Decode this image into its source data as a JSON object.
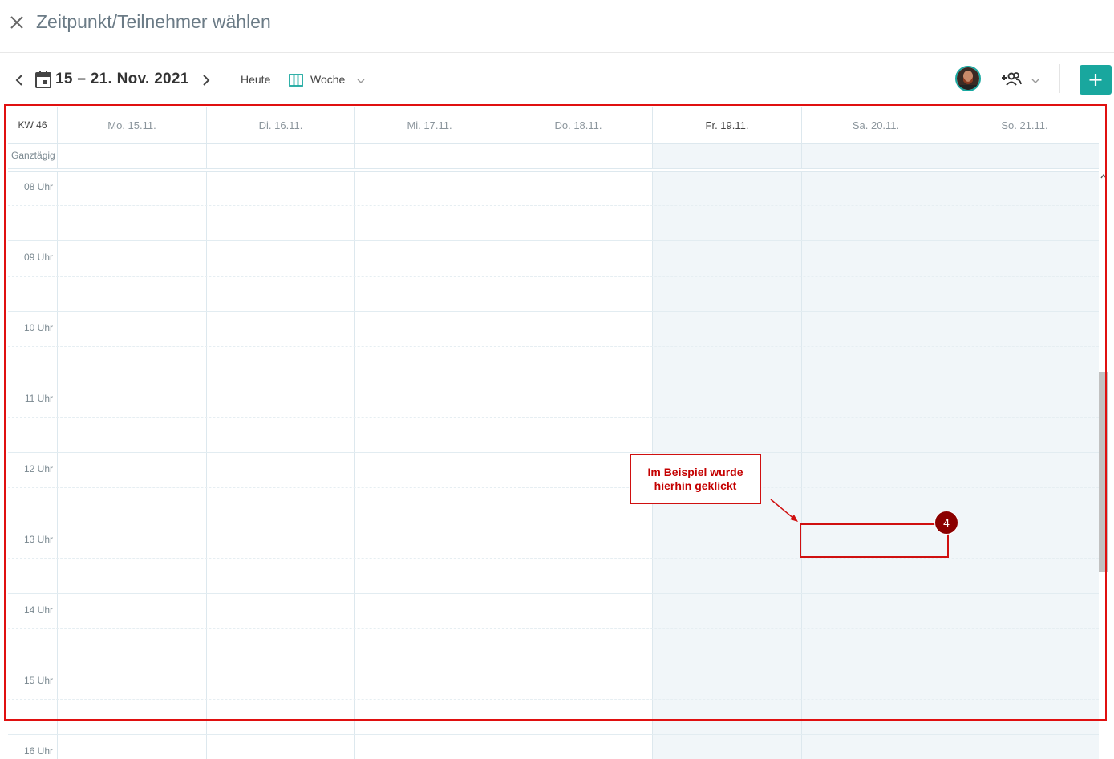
{
  "window": {
    "title": "Zeitpunkt/Teilnehmer wählen"
  },
  "toolbar": {
    "date_range": "15 – 21. Nov. 2021",
    "today_label": "Heute",
    "view_label": "Woche"
  },
  "calendar": {
    "week_label": "KW 46",
    "allday_label": "Ganztägig",
    "days": [
      "Mo. 15.11.",
      "Di. 16.11.",
      "Mi. 17.11.",
      "Do. 18.11.",
      "Fr. 19.11.",
      "Sa. 20.11.",
      "So. 21.11."
    ],
    "hours": [
      "08 Uhr",
      "09 Uhr",
      "10 Uhr",
      "11 Uhr",
      "12 Uhr",
      "13 Uhr",
      "14 Uhr",
      "15 Uhr",
      "16 Uhr"
    ]
  },
  "annotation": {
    "callout_text": "Im Beispiel wurde hierhin geklickt",
    "badge": "4",
    "color": "#d01010"
  },
  "colors": {
    "accent": "#19a79e",
    "weekend_bg": "#f1f6f9",
    "badge": "#8b0000"
  }
}
